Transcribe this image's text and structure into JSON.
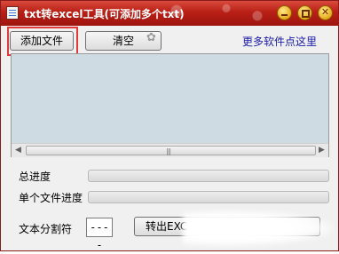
{
  "window": {
    "title": "txt转excel工具(可添加多个txt)",
    "controls": {
      "min_icon": "minimize-icon",
      "max_icon": "maximize-icon",
      "close_glyph": "✕"
    }
  },
  "toolbar": {
    "add_file_label": "添加文件",
    "clear_label": "清空",
    "more_software_link": "更多软件点这里"
  },
  "file_list": {
    "items": [],
    "scroll_grip": "|||"
  },
  "progress": {
    "total_label": "总进度",
    "total_value": 0,
    "single_label": "单个文件进度",
    "single_value": 0
  },
  "footer": {
    "separator_label": "文本分割符",
    "separator_value": "----",
    "export_label": "转出EXC"
  },
  "colors": {
    "title_bar": "#b81f16",
    "focus_ring": "#e03a3a",
    "list_background": "#cfdbe3",
    "link": "#1a1aa6"
  }
}
